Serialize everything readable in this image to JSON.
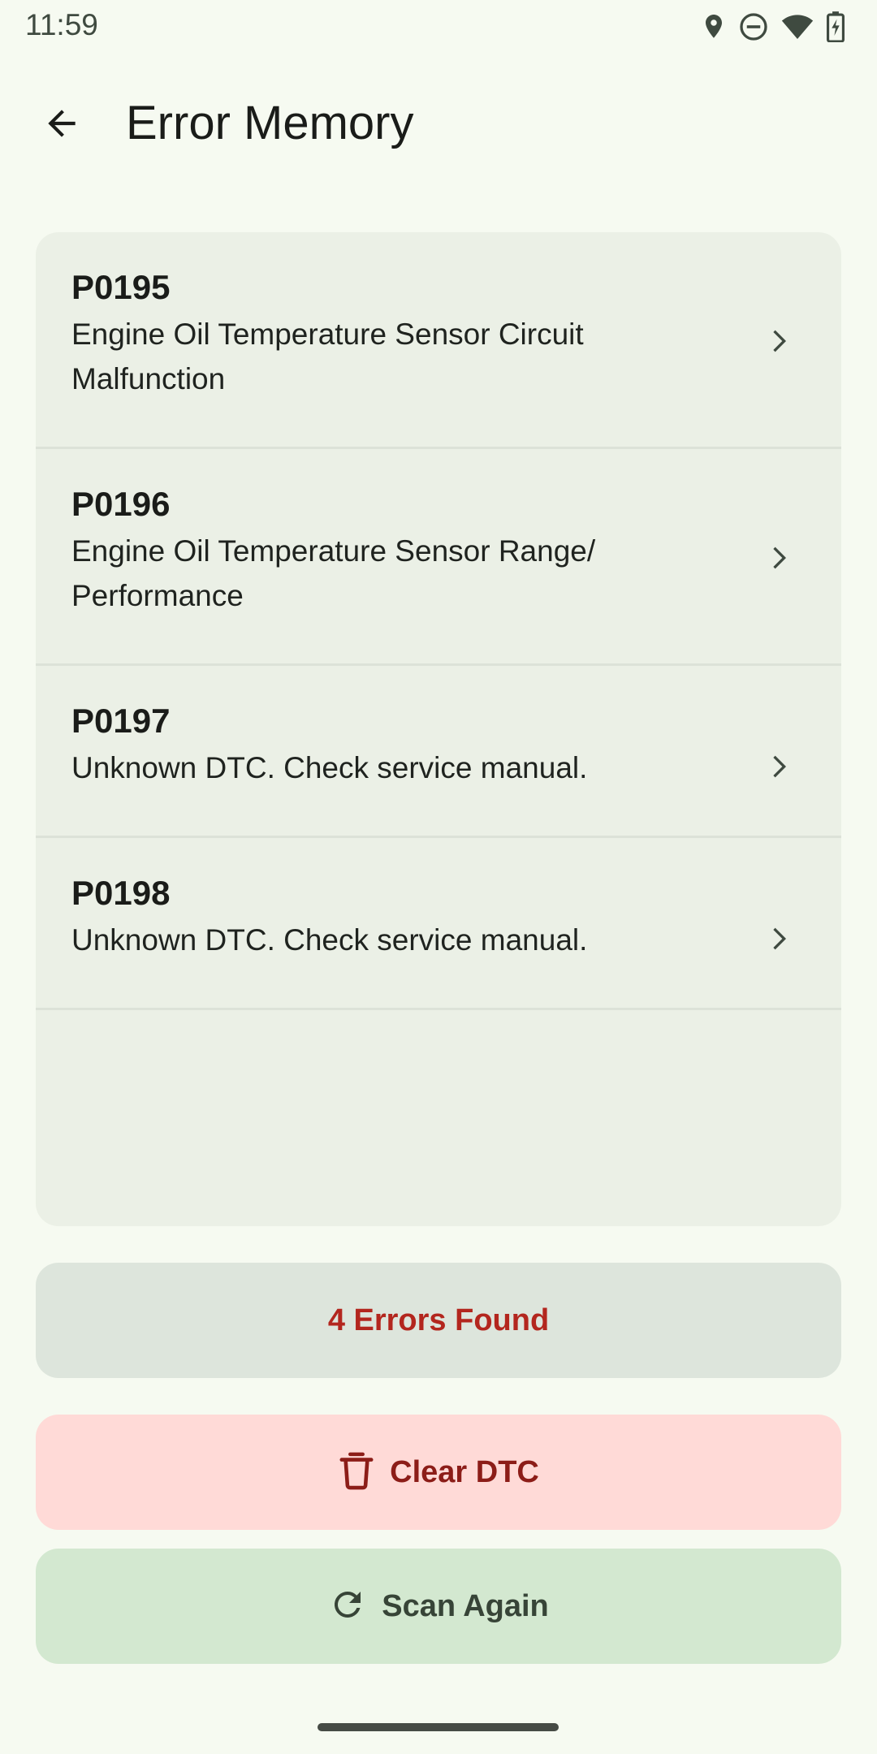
{
  "status_bar": {
    "time": "11:59",
    "icons": [
      "location-icon",
      "do-not-disturb-icon",
      "wifi-icon",
      "battery-charging-icon"
    ]
  },
  "app_bar": {
    "back_icon": "arrow-back-icon",
    "title": "Error Memory"
  },
  "dtc_list": [
    {
      "code": "P0195",
      "description": "Engine Oil Temperature Sensor Circuit Malfunction"
    },
    {
      "code": "P0196",
      "description": "Engine Oil Temperature Sensor Range/ Performance"
    },
    {
      "code": "P0197",
      "description": "Unknown DTC. Check service manual."
    },
    {
      "code": "P0198",
      "description": "Unknown DTC. Check service manual."
    }
  ],
  "summary": {
    "errors_found": "4 Errors Found"
  },
  "actions": {
    "clear_label": "Clear DTC",
    "clear_icon": "trash-icon",
    "scan_label": "Scan Again",
    "scan_icon": "refresh-icon"
  },
  "colors": {
    "background": "#f6faf1",
    "card": "#ebf0e6",
    "error_text": "#b3261e",
    "clear_button_bg": "#ffdad7",
    "scan_button_bg": "#d3e8d0"
  }
}
